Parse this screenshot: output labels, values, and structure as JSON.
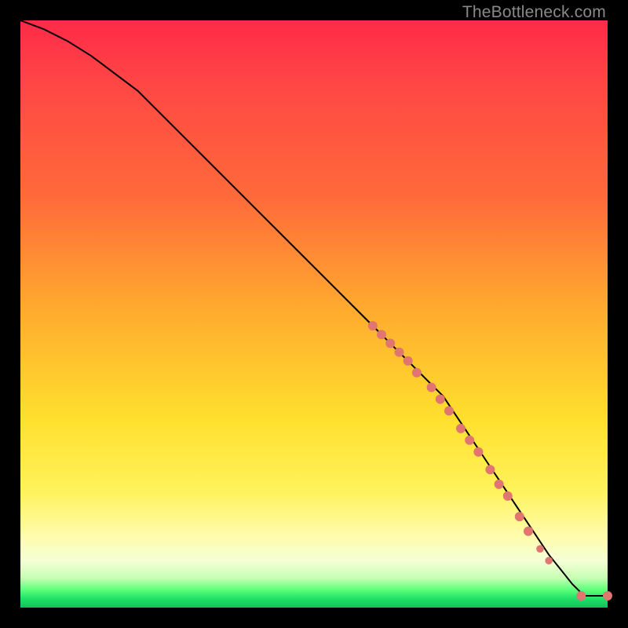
{
  "watermark": "TheBottleneck.com",
  "colors": {
    "dot": "#e0766f",
    "line": "#000000",
    "gradient_top": "#ff2a49",
    "gradient_bottom": "#10c25a"
  },
  "chart_data": {
    "type": "line",
    "title": "",
    "xlabel": "",
    "ylabel": "",
    "xlim": [
      0,
      100
    ],
    "ylim": [
      0,
      100
    ],
    "grid": false,
    "legend": false,
    "series": [
      {
        "name": "curve",
        "x": [
          0,
          4,
          8,
          12,
          20,
          30,
          40,
          50,
          58,
          60,
          62,
          64,
          66,
          68,
          70,
          72,
          74,
          76,
          78,
          80,
          82,
          84,
          86,
          88,
          90,
          92,
          94,
          96,
          100
        ],
        "y": [
          100,
          98.5,
          96.5,
          94,
          88,
          78,
          68,
          58,
          50,
          48,
          46,
          44,
          42,
          40,
          38,
          36,
          33,
          30,
          27,
          24,
          21,
          18,
          15,
          12,
          9,
          6.5,
          4,
          2,
          2
        ]
      }
    ],
    "markers": [
      {
        "x": 60.0,
        "y": 48.0,
        "r": 1.0
      },
      {
        "x": 61.5,
        "y": 46.5,
        "r": 1.0
      },
      {
        "x": 63.0,
        "y": 45.0,
        "r": 1.0
      },
      {
        "x": 64.5,
        "y": 43.5,
        "r": 1.0
      },
      {
        "x": 66.0,
        "y": 42.0,
        "r": 1.0
      },
      {
        "x": 67.5,
        "y": 40.0,
        "r": 1.0
      },
      {
        "x": 70.0,
        "y": 37.5,
        "r": 1.0
      },
      {
        "x": 71.5,
        "y": 35.5,
        "r": 1.0
      },
      {
        "x": 73.0,
        "y": 33.5,
        "r": 1.0
      },
      {
        "x": 75.0,
        "y": 30.5,
        "r": 1.0
      },
      {
        "x": 76.5,
        "y": 28.5,
        "r": 1.0
      },
      {
        "x": 78.0,
        "y": 26.5,
        "r": 1.0
      },
      {
        "x": 80.0,
        "y": 23.5,
        "r": 1.0
      },
      {
        "x": 81.5,
        "y": 21.0,
        "r": 1.0
      },
      {
        "x": 83.0,
        "y": 19.0,
        "r": 1.0
      },
      {
        "x": 85.0,
        "y": 15.5,
        "r": 1.0
      },
      {
        "x": 86.5,
        "y": 13.0,
        "r": 1.0
      },
      {
        "x": 88.5,
        "y": 10.0,
        "r": 0.8
      },
      {
        "x": 90.0,
        "y": 8.0,
        "r": 0.8
      },
      {
        "x": 95.5,
        "y": 2.0,
        "r": 1.0
      },
      {
        "x": 100.0,
        "y": 2.0,
        "r": 1.0
      }
    ]
  }
}
